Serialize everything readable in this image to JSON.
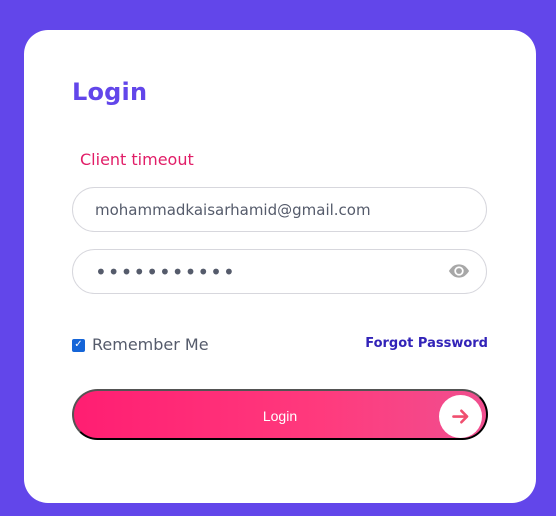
{
  "page": {
    "background_color": "#6246ea"
  },
  "login_card": {
    "title": "Login",
    "error_message": "Client timeout",
    "email": {
      "value": "mohammadkaisarhamid@gmail.com",
      "placeholder": ""
    },
    "password": {
      "value": "•••••••••••",
      "visibility_icon": "eye-icon"
    },
    "remember_me": {
      "label": "Remember Me",
      "checked": true
    },
    "forgot_password_label": "Forgot Password",
    "login_button": {
      "label": "Login",
      "icon": "arrow-right-icon"
    }
  },
  "colors": {
    "accent": "#6246ea",
    "error": "#e11d67",
    "button_gradient_start": "#ff1e72",
    "button_gradient_end": "#f04f8f",
    "link": "#3223b8"
  }
}
